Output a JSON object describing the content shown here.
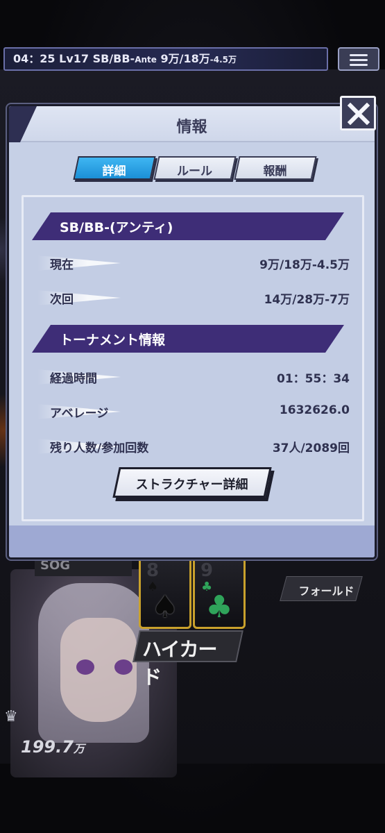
{
  "status_bar": {
    "time": "04：25",
    "level": "Lv17",
    "blinds_label": "SB/BB-",
    "ante_label": "Ante",
    "blinds": "9万/18万",
    "ante": "-4.5万"
  },
  "modal": {
    "title": "情報",
    "tabs": [
      {
        "label": "詳細",
        "active": true
      },
      {
        "label": "ルール",
        "active": false
      },
      {
        "label": "報酬",
        "active": false
      }
    ],
    "blinds_section": {
      "heading": "SB/BB-(アンティ)",
      "rows": [
        {
          "label": "現在",
          "value": "9万/18万-4.5万"
        },
        {
          "label": "次回",
          "value": "14万/28万-7万"
        }
      ]
    },
    "tournament_section": {
      "heading": "トーナメント情報",
      "rows": [
        {
          "label": "経過時間",
          "value": "01：55：34"
        },
        {
          "label": "アベレージ",
          "value": "1632626.0"
        },
        {
          "label": "残り人数/参加回数",
          "value": "37人/2089回"
        }
      ]
    },
    "structure_button": "ストラクチャー詳細"
  },
  "game": {
    "player_name": "SOG",
    "cards": [
      {
        "rank": "8",
        "suit": "♠"
      },
      {
        "rank": "9",
        "suit": "♣"
      }
    ],
    "hand_rank": "ハイカード",
    "fold_label": "フォールド",
    "chips_value": "199.7",
    "chips_unit": "万"
  },
  "colors": {
    "accent_purple": "#3e2d77",
    "tab_active_blue": "#1b8fd6",
    "card_gold": "#c9a12c",
    "club_green": "#2fa35a"
  }
}
